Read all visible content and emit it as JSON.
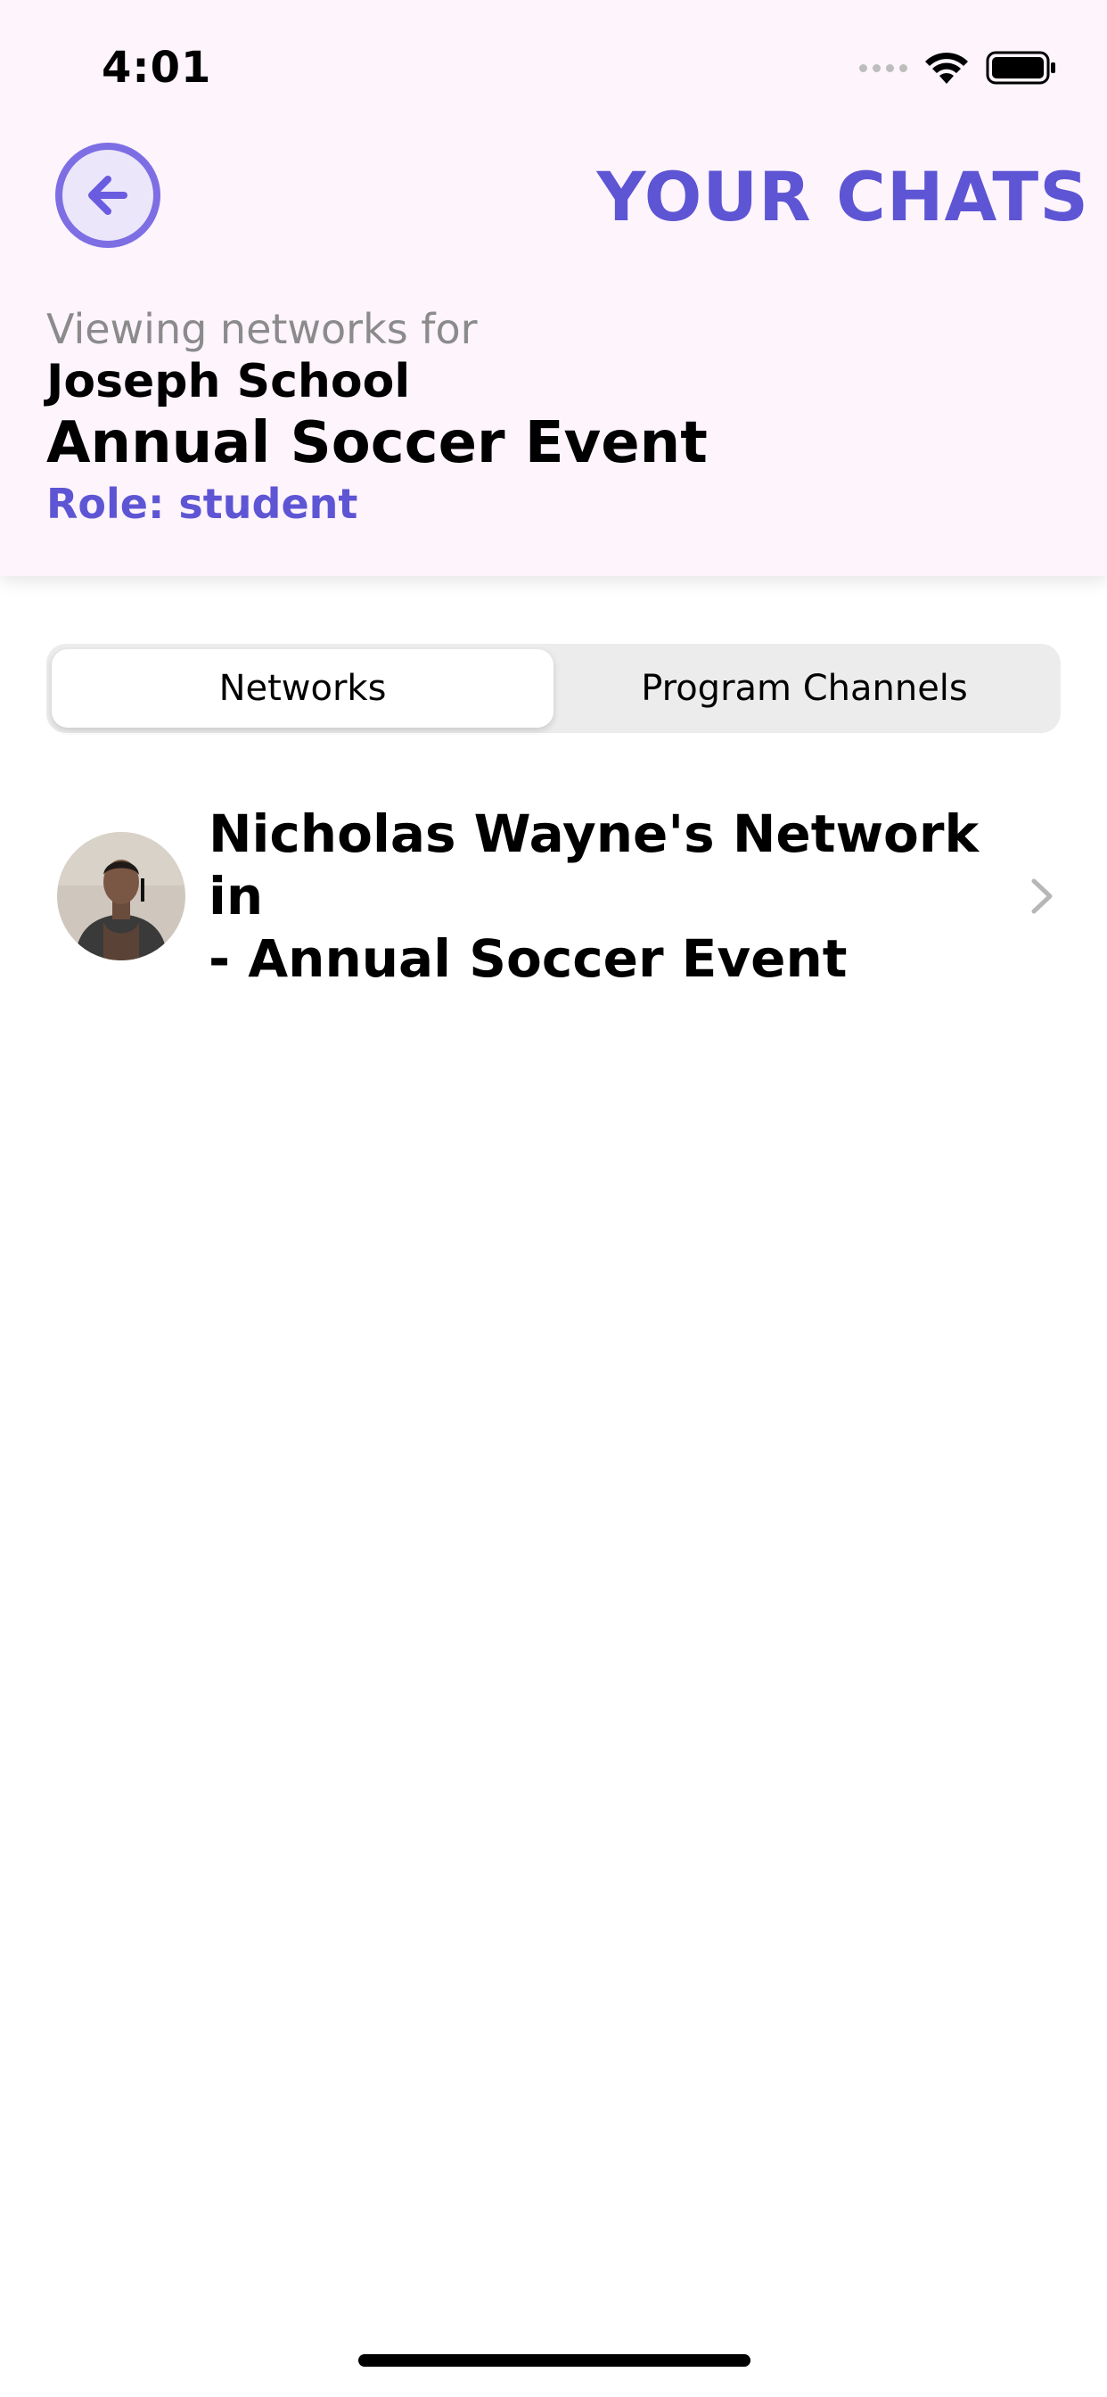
{
  "status_bar": {
    "time": "4:01"
  },
  "header": {
    "title": "YOUR CHATS",
    "viewing_label": "Viewing networks for",
    "school": "Joseph School",
    "event": "Annual Soccer Event",
    "role": "Role: student"
  },
  "tabs": [
    {
      "label": "Networks",
      "active": true
    },
    {
      "label": "Program Channels",
      "active": false
    }
  ],
  "networks": [
    {
      "title": "Nicholas Wayne's Network in\n- Annual Soccer Event",
      "avatar": "profile-photo"
    }
  ],
  "colors": {
    "accent": "#5e55d4",
    "header_bg": "#fdf4fc",
    "back_button_border": "#7d6ee4"
  }
}
